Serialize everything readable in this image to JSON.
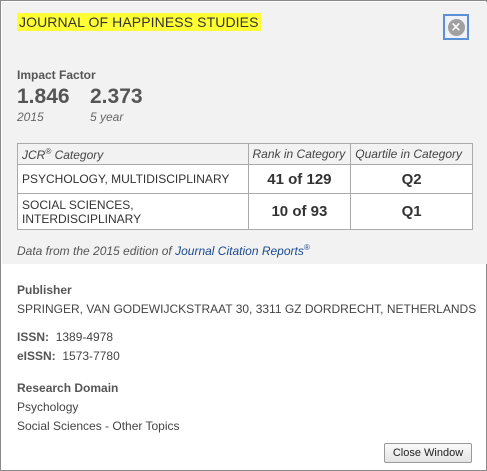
{
  "journal": {
    "title": "JOURNAL OF HAPPINESS STUDIES"
  },
  "impact": {
    "label": "Impact Factor",
    "values": [
      {
        "value": "1.846",
        "sub": "2015"
      },
      {
        "value": "2.373",
        "sub": "5 year"
      }
    ]
  },
  "ranking": {
    "headers": {
      "jcr": "JCR",
      "reg": "®",
      "category": " Category",
      "rank": "Rank in Category",
      "quartile": "Quartile in Category"
    },
    "rows": [
      {
        "category": "PSYCHOLOGY, MULTIDISCIPLINARY",
        "rank": "41 of 129",
        "quartile": "Q2"
      },
      {
        "category_line1": "SOCIAL SCIENCES,",
        "category_line2": "INTERDISCIPLINARY",
        "rank": "10 of 93",
        "quartile": "Q1"
      }
    ]
  },
  "data_note": {
    "prefix": "Data from the 2015 edition of ",
    "link": "Journal Citation Reports",
    "reg": "®"
  },
  "publisher": {
    "label": "Publisher",
    "value": "SPRINGER, VAN GODEWIJCKSTRAAT 30, 3311 GZ DORDRECHT, NETHERLANDS"
  },
  "issn": {
    "label": "ISSN:",
    "value": "1389-4978"
  },
  "eissn": {
    "label": "eISSN:",
    "value": "1573-7780"
  },
  "research_domain": {
    "label": "Research Domain",
    "items": [
      "Psychology",
      "Social Sciences - Other Topics"
    ]
  },
  "buttons": {
    "close_window": "Close Window"
  }
}
